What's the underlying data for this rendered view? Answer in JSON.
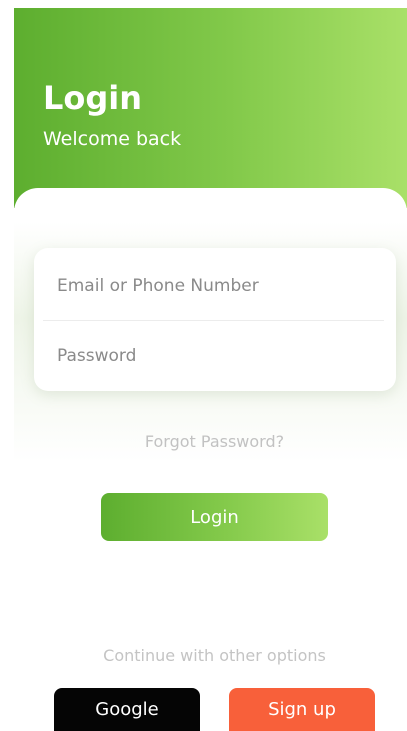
{
  "header": {
    "title": "Login",
    "subtitle": "Welcome back"
  },
  "form": {
    "email_placeholder": "Email or Phone Number",
    "email_value": "",
    "password_placeholder": "Password",
    "password_value": ""
  },
  "links": {
    "forgot_password": "Forgot Password?"
  },
  "actions": {
    "login_label": "Login",
    "continue_text": "Continue with other options",
    "google_label": "Google",
    "signup_label": "Sign up"
  },
  "colors": {
    "brand_green_start": "#5dae2f",
    "brand_green_end": "#a9e068",
    "google_bg": "#050505",
    "signup_bg": "#f8603a"
  }
}
